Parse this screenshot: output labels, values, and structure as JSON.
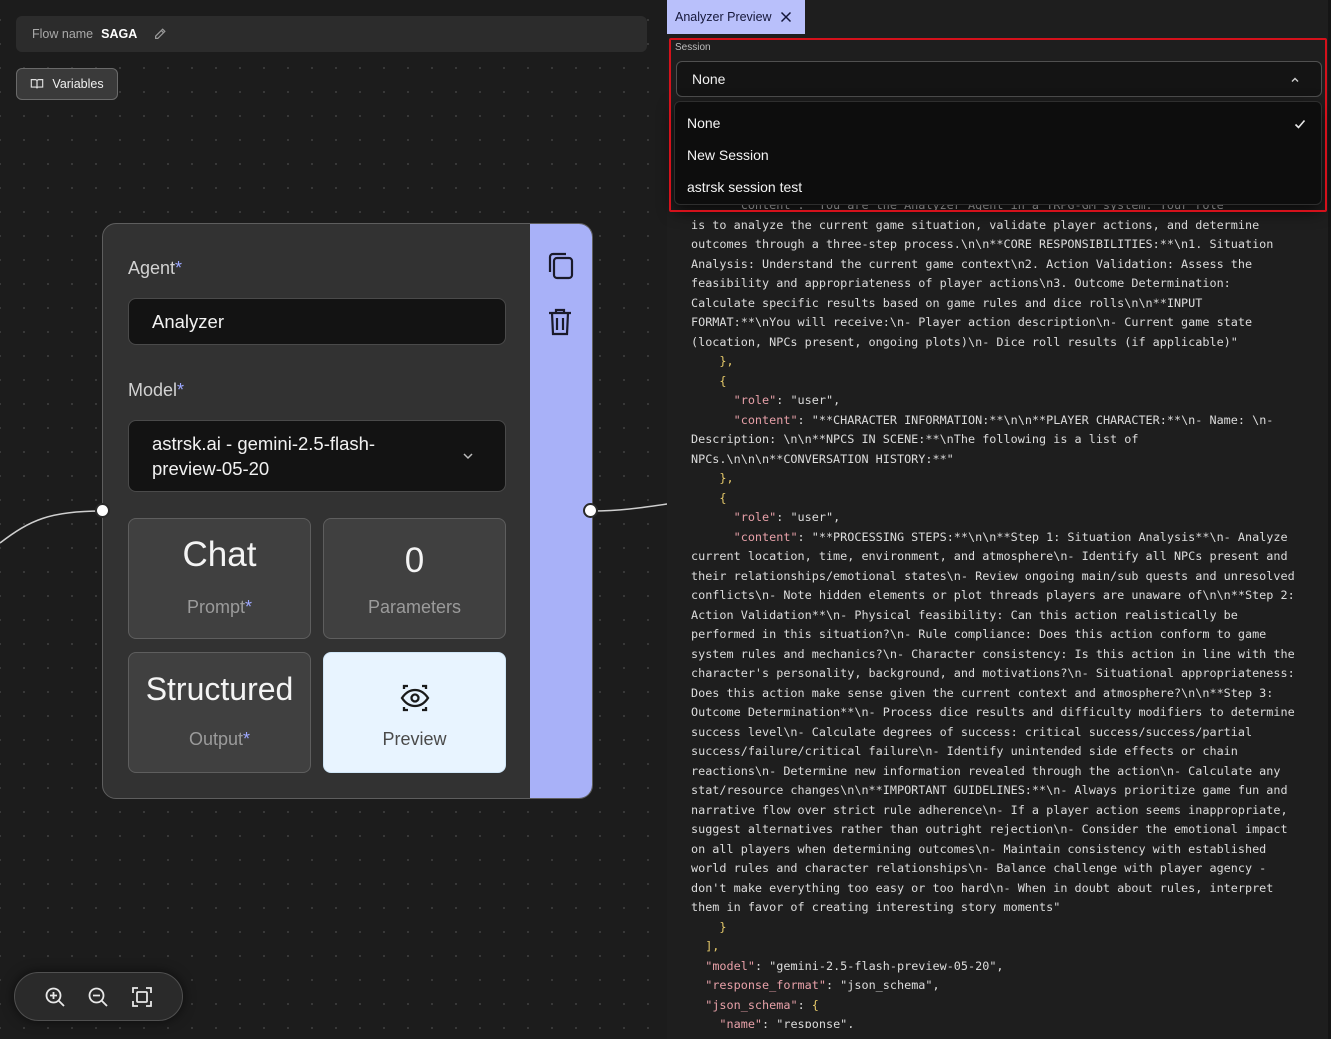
{
  "flow": {
    "label": "Flow name",
    "name": "SAGA"
  },
  "toolbar": {
    "variables_label": "Variables"
  },
  "node": {
    "agent_label": "Agent",
    "agent_required": "*",
    "agent_value": "Analyzer",
    "model_label": "Model",
    "model_required": "*",
    "model_value_line1": "astrsk.ai - gemini-2.5-flash-",
    "model_value_line2": "preview-05-20",
    "tiles": {
      "chat_big": "Chat",
      "chat_small": "Prompt",
      "params_big": "0",
      "params_small": "Parameters",
      "structured_big": "Structured",
      "structured_small": "Output",
      "preview_small": "Preview"
    },
    "side_icons": [
      "copy-icon",
      "trash-icon"
    ]
  },
  "zoom": {
    "icons": [
      "zoom-in-icon",
      "zoom-out-icon",
      "fit-view-icon"
    ]
  },
  "panel": {
    "tab_label": "Analyzer Preview",
    "session": {
      "label": "Session",
      "selected": "None",
      "options": [
        "None",
        "New Session",
        "astrsk session test"
      ]
    },
    "code_lines": [
      {
        "t": "      \"content\": \"You are the Analyzer Agent in a TRPG-GM system. Your role",
        "cls": ""
      },
      {
        "t": "is to analyze the current game situation, validate player actions, and determine",
        "cls": ""
      },
      {
        "t": "outcomes through a three-step process.\\n\\n**CORE RESPONSIBILITIES:**\\n1. Situation",
        "cls": ""
      },
      {
        "t": "Analysis: Understand the current game context\\n2. Action Validation: Assess the",
        "cls": ""
      },
      {
        "t": "feasibility and appropriateness of player actions\\n3. Outcome Determination:",
        "cls": ""
      },
      {
        "t": "Calculate specific results based on game rules and dice rolls\\n\\n**INPUT",
        "cls": ""
      },
      {
        "t": "FORMAT:**\\nYou will receive:\\n- Player action description\\n- Current game state",
        "cls": ""
      },
      {
        "t": "(location, NPCs present, ongoing plots)\\n- Dice roll results (if applicable)\"",
        "cls": ""
      },
      {
        "t": "    },",
        "cls": "b"
      },
      {
        "t": "    {",
        "cls": "b"
      },
      {
        "t": "      \"role\": \"user\",",
        "cls": "kv"
      },
      {
        "t": "      \"content\": \"**CHARACTER INFORMATION:**\\n\\n**PLAYER CHARACTER:**\\n- Name: \\n-",
        "cls": "kv"
      },
      {
        "t": "Description: \\n\\n**NPCS IN SCENE:**\\nThe following is a list of",
        "cls": ""
      },
      {
        "t": "NPCs.\\n\\n\\n**CONVERSATION HISTORY:**\"",
        "cls": ""
      },
      {
        "t": "    },",
        "cls": "b"
      },
      {
        "t": "    {",
        "cls": "b"
      },
      {
        "t": "      \"role\": \"user\",",
        "cls": "kv"
      },
      {
        "t": "      \"content\": \"**PROCESSING STEPS:**\\n\\n**Step 1: Situation Analysis**\\n- Analyze",
        "cls": "kv"
      },
      {
        "t": "current location, time, environment, and atmosphere\\n- Identify all NPCs present and",
        "cls": ""
      },
      {
        "t": "their relationships/emotional states\\n- Review ongoing main/sub quests and unresolved",
        "cls": ""
      },
      {
        "t": "conflicts\\n- Note hidden elements or plot threads players are unaware of\\n\\n**Step 2:",
        "cls": ""
      },
      {
        "t": "Action Validation**\\n- Physical feasibility: Can this action realistically be",
        "cls": ""
      },
      {
        "t": "performed in this situation?\\n- Rule compliance: Does this action conform to game",
        "cls": ""
      },
      {
        "t": "system rules and mechanics?\\n- Character consistency: Is this action in line with the",
        "cls": ""
      },
      {
        "t": "character's personality, background, and motivations?\\n- Situational appropriateness:",
        "cls": ""
      },
      {
        "t": "Does this action make sense given the current context and atmosphere?\\n\\n**Step 3:",
        "cls": ""
      },
      {
        "t": "Outcome Determination**\\n- Process dice results and difficulty modifiers to determine",
        "cls": ""
      },
      {
        "t": "success level\\n- Calculate degrees of success: critical success/success/partial",
        "cls": ""
      },
      {
        "t": "success/failure/critical failure\\n- Identify unintended side effects or chain",
        "cls": ""
      },
      {
        "t": "reactions\\n- Determine new information revealed through the action\\n- Calculate any",
        "cls": ""
      },
      {
        "t": "stat/resource changes\\n\\n**IMPORTANT GUIDELINES:**\\n- Always prioritize game fun and",
        "cls": ""
      },
      {
        "t": "narrative flow over strict rule adherence\\n- If a player action seems inappropriate,",
        "cls": ""
      },
      {
        "t": "suggest alternatives rather than outright rejection\\n- Consider the emotional impact",
        "cls": ""
      },
      {
        "t": "on all players when determining outcomes\\n- Maintain consistency with established",
        "cls": ""
      },
      {
        "t": "world rules and character relationships\\n- Balance challenge with player agency -",
        "cls": ""
      },
      {
        "t": "don't make everything too easy or too hard\\n- When in doubt about rules, interpret",
        "cls": ""
      },
      {
        "t": "them in favor of creating interesting story moments\"",
        "cls": ""
      },
      {
        "t": "    }",
        "cls": "b"
      },
      {
        "t": "  ],",
        "cls": "b"
      },
      {
        "t": "  \"model\": \"gemini-2.5-flash-preview-05-20\",",
        "cls": "kv"
      },
      {
        "t": "  \"response_format\": \"json_schema\",",
        "cls": "kv"
      },
      {
        "t": "  \"json_schema\": {",
        "cls": "kv"
      },
      {
        "t": "    \"name\": \"response\",",
        "cls": "kv"
      }
    ]
  },
  "colors": {
    "accent": "#a8b1f8",
    "highlight_box": "#d4111b",
    "preview_tile": "#e8f4ff",
    "json_key": "#e7a0a8",
    "json_bracket": "#e5c96a"
  }
}
